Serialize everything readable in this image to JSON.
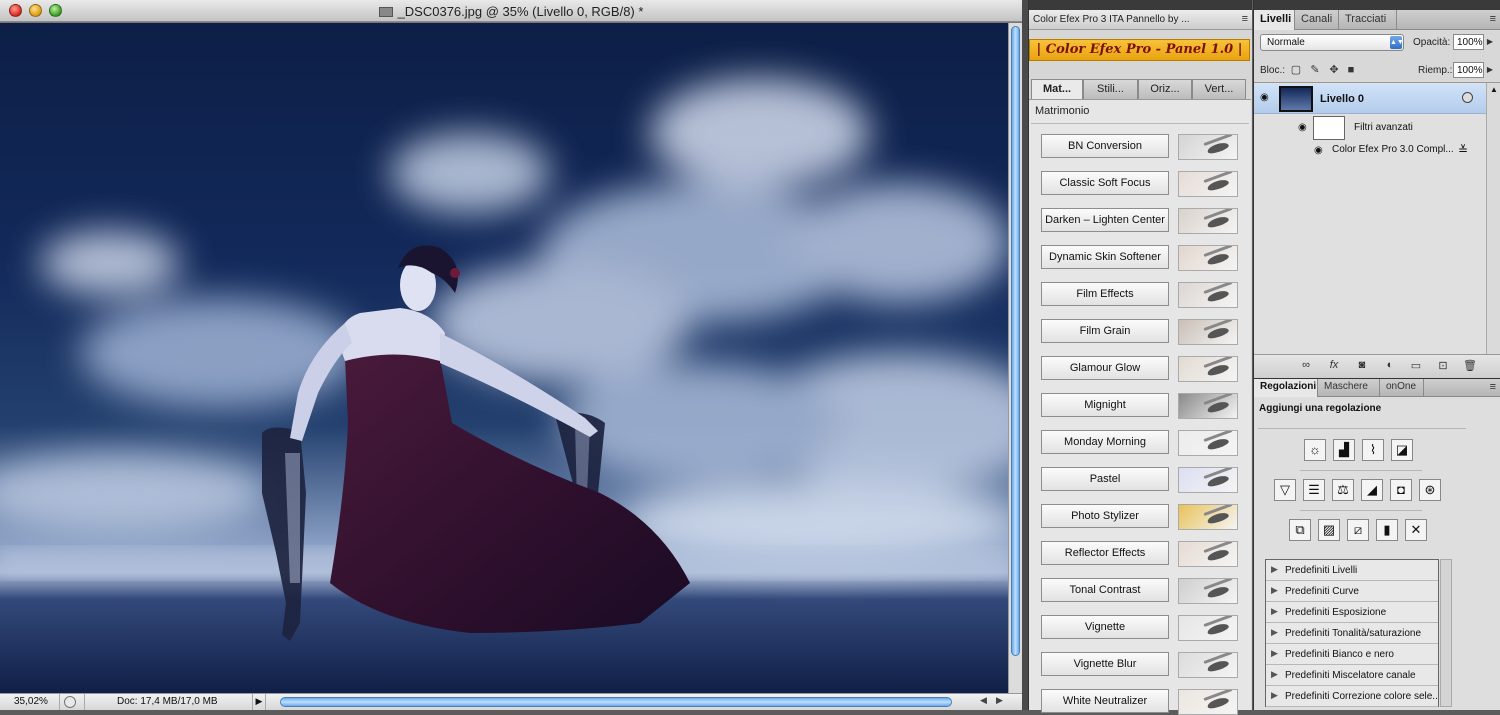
{
  "document": {
    "title": "_DSC0376.jpg @ 35% (Livello 0, RGB/8) *",
    "zoom": "35,02%",
    "doc_info": "Doc: 17,4 MB/17,0 MB"
  },
  "color_efex": {
    "panel_title": "Color Efex Pro 3 ITA Pannello by ...",
    "banner": "| Color Efex Pro - Panel 1.0 |",
    "tabs": [
      {
        "label": "Mat..."
      },
      {
        "label": "Stili..."
      },
      {
        "label": "Oriz..."
      },
      {
        "label": "Vert..."
      }
    ],
    "active_tab_index": 0,
    "section": "Matrimonio",
    "filters": [
      {
        "label": "BN Conversion",
        "thumb_color": "#d4d4d4"
      },
      {
        "label": "Classic Soft Focus",
        "thumb_color": "#e6dcd6"
      },
      {
        "label": "Darken – Lighten Center",
        "thumb_color": "#d9d2cc"
      },
      {
        "label": "Dynamic Skin Softener",
        "thumb_color": "#e2d6ce"
      },
      {
        "label": "Film Effects",
        "thumb_color": "#ddd6d2"
      },
      {
        "label": "Film Grain",
        "thumb_color": "#c9bfb6"
      },
      {
        "label": "Glamour Glow",
        "thumb_color": "#e2dbd2"
      },
      {
        "label": "Mignight",
        "thumb_color": "#8a8a8a"
      },
      {
        "label": "Monday Morning",
        "thumb_color": "#ececec"
      },
      {
        "label": "Pastel",
        "thumb_color": "#dcdff2"
      },
      {
        "label": "Photo Stylizer",
        "thumb_color": "#e8c25a"
      },
      {
        "label": "Reflector Effects",
        "thumb_color": "#e6dcd2"
      },
      {
        "label": "Tonal Contrast",
        "thumb_color": "#cfcfcf"
      },
      {
        "label": "Vignette",
        "thumb_color": "#e6e6e6"
      },
      {
        "label": "Vignette Blur",
        "thumb_color": "#dcdcdc"
      },
      {
        "label": "White Neutralizer",
        "thumb_color": "#ece6e0"
      }
    ]
  },
  "layers": {
    "tabs": [
      "Livelli",
      "Canali",
      "Tracciati"
    ],
    "blend_mode": "Normale",
    "opacity_label": "Opacità:",
    "opacity": "100%",
    "lock_label": "Bloc.:",
    "fill_label": "Riemp.:",
    "fill": "100%",
    "layer_name": "Livello 0",
    "smart_filters_label": "Filtri avanzati",
    "smart_filter_name": "Color Efex Pro 3.0 Compl..."
  },
  "adjustments": {
    "tabs": [
      "Regolazioni",
      "Maschere",
      "onOne"
    ],
    "heading": "Aggiungi una regolazione",
    "presets": [
      "Predefiniti Livelli",
      "Predefiniti Curve",
      "Predefiniti Esposizione",
      "Predefiniti Tonalità/saturazione",
      "Predefiniti Bianco e nero",
      "Predefiniti Miscelatore canale",
      "Predefiniti Correzione colore sele..."
    ]
  },
  "colors": {
    "accent_blue": "#6aa9e8",
    "banner_orange": "#f7c23a",
    "banner_text": "#7a1010",
    "selected_layer": "#cfe2f7"
  }
}
